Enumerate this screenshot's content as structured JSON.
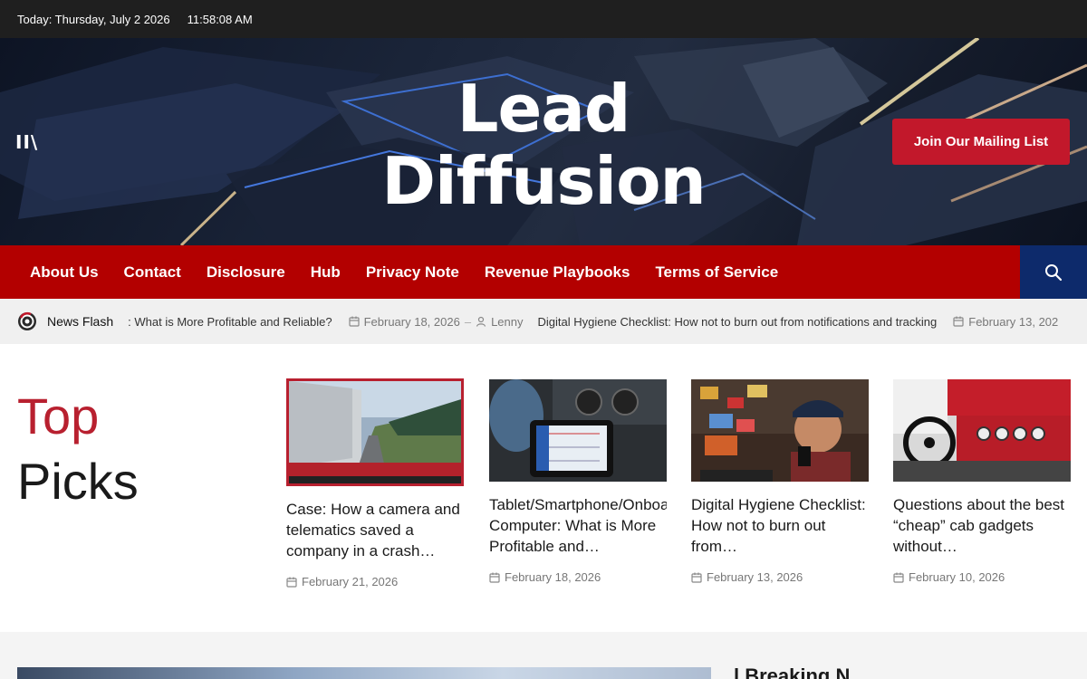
{
  "topbar": {
    "date": "Today: Thursday, July 2 2026",
    "time": "11:58:08 AM"
  },
  "hero": {
    "menu_toggle": "II\\",
    "brand_line1": "Lead",
    "brand_line2": "Diffusion",
    "join_button": "Join Our Mailing List"
  },
  "nav": {
    "items": [
      "About Us",
      "Contact",
      "Disclosure",
      "Hub",
      "Privacy Note",
      "Revenue Playbooks",
      "Terms of Service"
    ],
    "search_icon": "search-icon"
  },
  "ticker": {
    "label": "News Flash",
    "items": [
      {
        "title": ": What is More Profitable and Reliable?",
        "date": "February 18, 2026",
        "author": "Lenny"
      },
      {
        "title": "Digital Hygiene Checklist: How not to burn out from notifications and tracking",
        "date": "February 13, 202",
        "author": ""
      }
    ]
  },
  "top_picks": {
    "title_red": "Top",
    "title_dark": "Picks",
    "cards": [
      {
        "title": "Case: How a camera and telematics saved a company in a crash…",
        "date": "February 21, 2026"
      },
      {
        "title": "Tablet/Smartphone/Onboard Computer: What is More Profitable and…",
        "date": "February 18, 2026"
      },
      {
        "title": "Digital Hygiene Checklist: How not to burn out from…",
        "date": "February 13, 2026"
      },
      {
        "title": "Questions about the best “cheap” cab gadgets without…",
        "date": "February 10, 2026"
      }
    ]
  },
  "bottom": {
    "heading": "l Breaking N"
  },
  "colors": {
    "topbar": "#1f1f1f",
    "nav": "#b30000",
    "accent": "#c2182b",
    "search": "#0d2a6b"
  }
}
